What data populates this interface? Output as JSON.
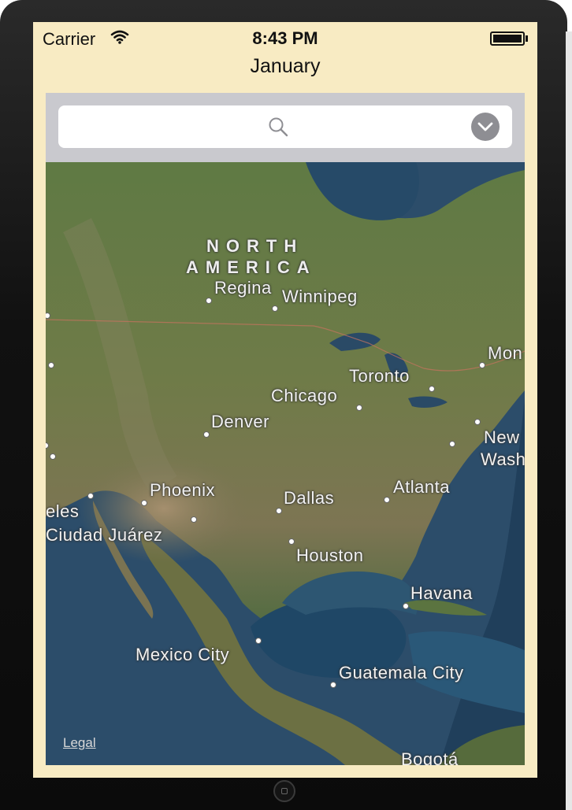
{
  "status_bar": {
    "carrier": "Carrier",
    "time": "8:43 PM"
  },
  "nav": {
    "title": "January"
  },
  "search": {
    "placeholder": ""
  },
  "map": {
    "continent_line1": "NORTH",
    "continent_line2": "AMERICA",
    "cities": {
      "regina": "Regina",
      "winnipeg": "Winnipeg",
      "toronto": "Toronto",
      "chicago": "Chicago",
      "denver": "Denver",
      "montreal": "Mon",
      "new_york": "New",
      "washington": "Washin",
      "phoenix": "Phoenix",
      "dallas": "Dallas",
      "atlanta": "Atlanta",
      "los_angeles": "eles",
      "ciudad_juarez": "Ciudad Juárez",
      "houston": "Houston",
      "havana": "Havana",
      "mexico_city": "Mexico City",
      "guatemala_city": "Guatemala City",
      "bogota": "Bogotá"
    },
    "legal": "Legal"
  },
  "colors": {
    "screen_bg": "#f8ebc3",
    "searchbar_bg": "#c9c9ce",
    "dropdown_button": "#8e8e93"
  },
  "icons": {
    "search": "search-icon",
    "dropdown": "chevron-down-icon",
    "wifi": "wifi-icon",
    "battery": "battery-icon"
  }
}
